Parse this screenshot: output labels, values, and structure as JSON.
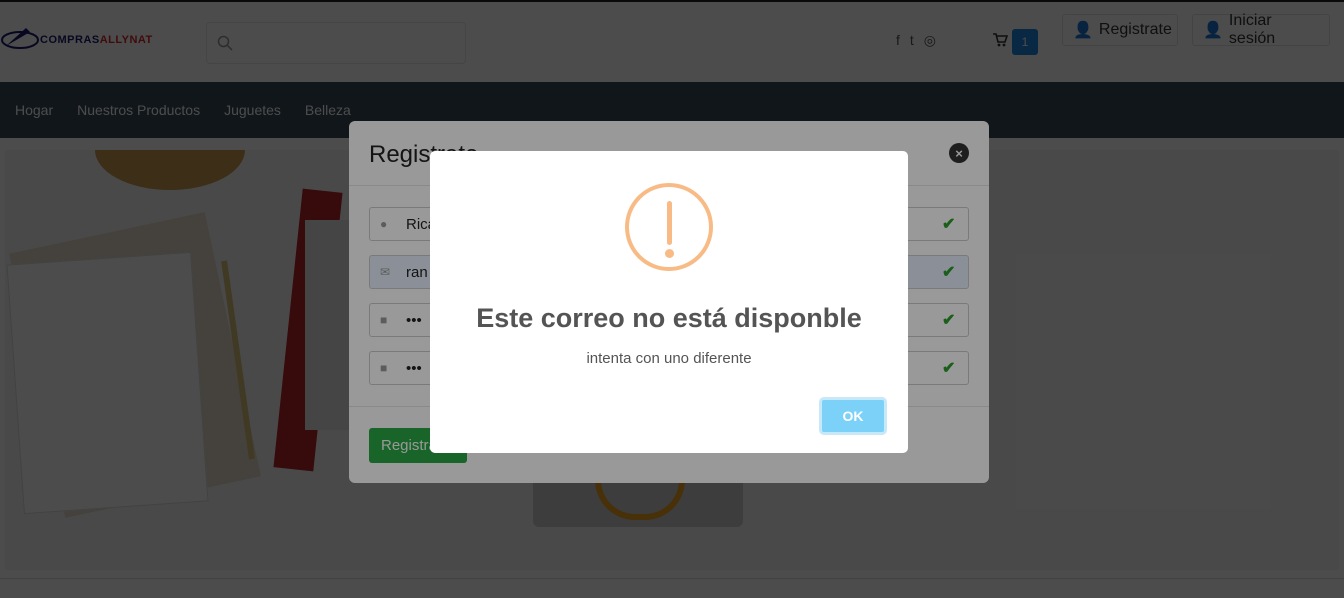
{
  "header": {
    "logo_text": "COMPRAS",
    "logo_sub": "ALLYNAT",
    "register_label": "Registrate",
    "login_label": "Iniciar sesión",
    "cart_count": "1"
  },
  "nav": {
    "items": [
      "Hogar",
      "Nuestros Productos",
      "Juguetes",
      "Belleza"
    ]
  },
  "modal": {
    "title": "Registrate",
    "fields": [
      {
        "icon": "user-icon",
        "value": "Rica"
      },
      {
        "icon": "envelope-icon",
        "value": "ran"
      },
      {
        "icon": "lock-icon",
        "value": "•••"
      },
      {
        "icon": "lock-icon",
        "value": "•••"
      }
    ],
    "submit_label": "Registrate"
  },
  "alert": {
    "title": "Este correo no está disponble",
    "text": "intenta con uno diferente",
    "ok_label": "OK",
    "icon": "warning-icon",
    "icon_color": "#f8bb86",
    "button_color": "#7cd1f9"
  }
}
